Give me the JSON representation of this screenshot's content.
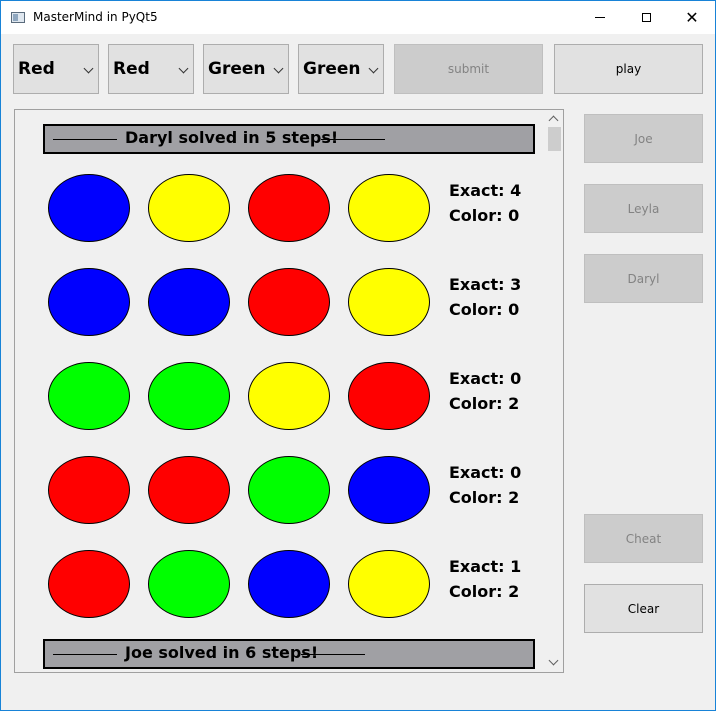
{
  "window": {
    "title": "MasterMind in PyQt5"
  },
  "toolbar": {
    "combos": [
      {
        "value": "Red"
      },
      {
        "value": "Red"
      },
      {
        "value": "Green"
      },
      {
        "value": "Green"
      }
    ],
    "submit_label": "submit",
    "play_label": "play"
  },
  "sidebar": {
    "players": [
      {
        "label": "Joe"
      },
      {
        "label": "Leyla"
      },
      {
        "label": "Daryl"
      }
    ],
    "cheat_label": "Cheat",
    "clear_label": "Clear"
  },
  "colors": {
    "red": "#ff0000",
    "yellow": "#ffff00",
    "blue": "#0000ff",
    "green": "#00ff00"
  },
  "board": {
    "banners": [
      {
        "text": "Daryl solved in 5 steps!"
      },
      {
        "text": "Joe solved in 6 steps!"
      }
    ],
    "rows": [
      {
        "pegs": [
          "blue",
          "yellow",
          "red",
          "yellow"
        ],
        "exact": "Exact: 4",
        "color": "Color: 0"
      },
      {
        "pegs": [
          "blue",
          "blue",
          "red",
          "yellow"
        ],
        "exact": "Exact: 3",
        "color": "Color: 0"
      },
      {
        "pegs": [
          "green",
          "green",
          "yellow",
          "red"
        ],
        "exact": "Exact: 0",
        "color": "Color: 2"
      },
      {
        "pegs": [
          "red",
          "red",
          "green",
          "blue"
        ],
        "exact": "Exact: 0",
        "color": "Color: 2"
      },
      {
        "pegs": [
          "red",
          "green",
          "blue",
          "yellow"
        ],
        "exact": "Exact: 1",
        "color": "Color: 2"
      }
    ]
  }
}
